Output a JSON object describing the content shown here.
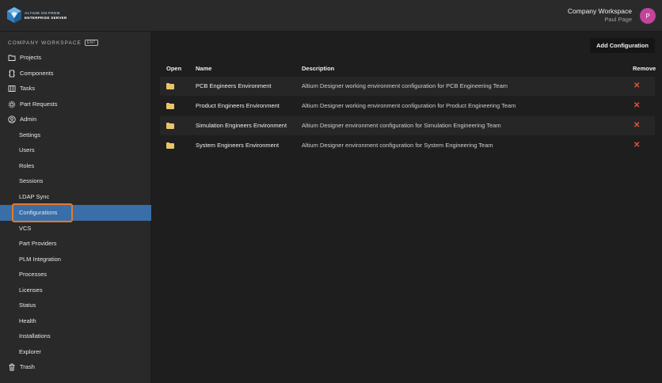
{
  "header": {
    "logo_line1": "ALTIUM ON-PREM",
    "logo_line2": "ENTERPRISE SERVER",
    "workspace_name": "Company Workspace",
    "user_name": "Paul Page",
    "avatar_initial": "P",
    "avatar_color": "#c2459b"
  },
  "sidebar": {
    "workspace_label": "COMPANY WORKSPACE",
    "badge": "ENT",
    "active_color": "#3a6ea8",
    "highlight_color": "#e8792a",
    "items": [
      {
        "label": "Projects",
        "icon": "folder-icon"
      },
      {
        "label": "Components",
        "icon": "component-icon"
      },
      {
        "label": "Tasks",
        "icon": "tasks-icon"
      },
      {
        "label": "Part Requests",
        "icon": "gear-icon"
      },
      {
        "label": "Admin",
        "icon": "user-icon"
      }
    ],
    "admin_items": [
      {
        "label": "Settings"
      },
      {
        "label": "Users"
      },
      {
        "label": "Roles"
      },
      {
        "label": "Sessions"
      },
      {
        "label": "LDAP Sync"
      },
      {
        "label": "Configurations",
        "active": true
      },
      {
        "label": "VCS"
      },
      {
        "label": "Part Providers"
      },
      {
        "label": "PLM Integration"
      },
      {
        "label": "Processes"
      },
      {
        "label": "Licenses"
      },
      {
        "label": "Status"
      },
      {
        "label": "Health"
      },
      {
        "label": "Installations"
      },
      {
        "label": "Explorer"
      }
    ],
    "trash": {
      "label": "Trash",
      "icon": "trash-icon"
    }
  },
  "main": {
    "add_button_label": "Add Configuration",
    "columns": {
      "open": "Open",
      "name": "Name",
      "description": "Description",
      "remove": "Remove"
    },
    "rows": [
      {
        "name": "PCB Engineers Environment",
        "description": "Altium Designer working environment configuration for PCB Engineering Team"
      },
      {
        "name": "Product Engineers Environment",
        "description": "Altium Designer working environment configuration for Product Engineering Team"
      },
      {
        "name": "Simulation Engineers Environment",
        "description": "Altium Designer environment configuration for Simulation Engineering Team"
      },
      {
        "name": "System Engineers Environment",
        "description": "Altium Designer environment configuration for System Engineering Team"
      }
    ],
    "folder_color": "#e9c46a",
    "remove_color": "#e5533d"
  }
}
